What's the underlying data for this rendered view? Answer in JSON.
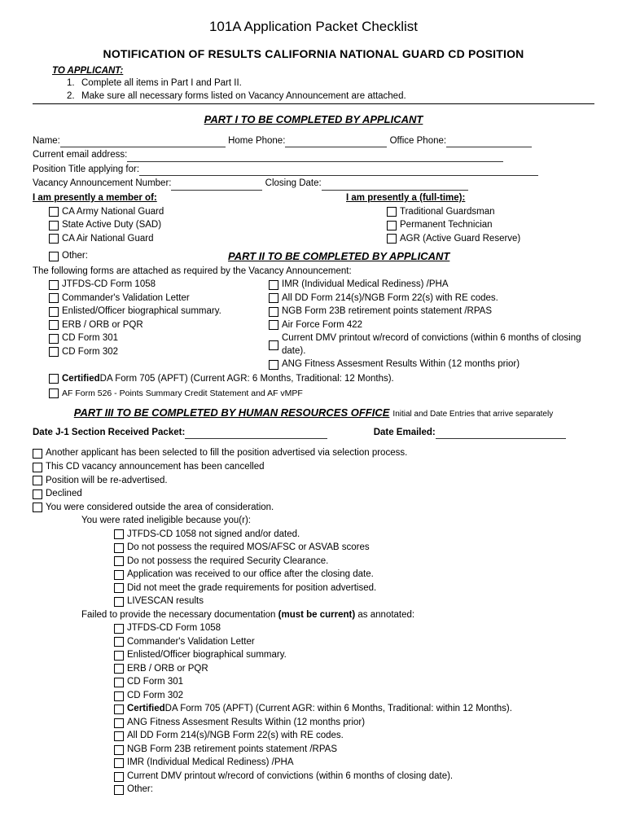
{
  "header": {
    "title": "101A Application Packet Checklist",
    "subtitle": "NOTIFICATION OF RESULTS CALIFORNIA NATIONAL GUARD  CD  POSITION",
    "to_applicant": "TO APPLICANT:",
    "instr1_num": "1.",
    "instr1": "Complete all items in Part I and Part II.",
    "instr2_num": "2.",
    "instr2": "Make sure all necessary forms listed on Vacancy Announcement are attached."
  },
  "part1": {
    "header": "PART I TO BE COMPLETED BY APPLICANT",
    "name": "Name:",
    "home_phone": "Home Phone:",
    "office_phone": "Office Phone:",
    "email": "Current email address:",
    "position": "Position Title applying for:",
    "vacancy": "Vacancy Announcement Number:",
    "closing": "Closing Date:",
    "member_hdr": "I am presently a member of:",
    "fulltime_hdr": "I am presently a (full-time):",
    "member_items": [
      "CA Army National Guard",
      "State Active Duty (SAD)",
      "CA Air National Guard"
    ],
    "fulltime_items": [
      "Traditional Guardsman",
      "Permanent Technician",
      "AGR (Active Guard Reserve)"
    ],
    "other": "Other:"
  },
  "part2": {
    "header": "PART II TO BE COMPLETED BY APPLICANT",
    "intro": "The following forms are attached as required by the Vacancy Announcement:",
    "left": [
      "JTFDS-CD Form 1058",
      "Commander's Validation Letter",
      "Enlisted/Officer biographical summary.",
      "ERB / ORB or PQR",
      "CD Form  301",
      "CD Form  302"
    ],
    "right": [
      "IMR (Individual Medical Rediness) /PHA",
      "All DD Form 214(s)/NGB Form 22(s) with RE codes.",
      "NGB Form 23B retirement points statement /RPAS",
      "Air Force Form 422",
      "Current DMV printout w/record of convictions (within 6 months of closing date).",
      "ANG Fitness Assesment Results Within (12 months prior)"
    ],
    "certified_b": "Certified",
    "certified_rest": " DA Form 705 (APFT) (Current AGR: 6 Months, Traditional: 12 Months).",
    "af526": "AF Form 526 - Points Summary Credit Statement and AF vMPF"
  },
  "part3": {
    "header": "PART III TO BE COMPLETED BY HUMAN RESOURCES OFFICE",
    "side_note": "Initial and Date Entries that arrive separately",
    "date_j1": "Date  J-1 Section Received Packet:",
    "date_emailed": "Date Emailed:",
    "top": [
      "Another applicant has been selected to fill the position advertised via selection process.",
      "This CD vacancy announcement has been cancelled",
      "Position will be re-advertised.",
      "Declined",
      "You were considered outside the area of consideration."
    ],
    "ineligible_hdr": "You were rated ineligible because you(r):",
    "ineligible": [
      "JTFDS-CD 1058  not signed and/or dated.",
      "Do not possess the required MOS/AFSC or ASVAB scores",
      "Do not possess the required Security Clearance.",
      "Application was received to our office after the closing date.",
      "Did not meet the grade requirements for position advertised.",
      "LIVESCAN results"
    ],
    "failed_pre": "Failed to provide the necessary documentation ",
    "failed_b": "(must be current)",
    "failed_post": " as annotated:",
    "docs": [
      "JTFDS-CD Form 1058",
      "Commander's Validation Letter",
      "Enlisted/Officer biographical summary.",
      "ERB / ORB or PQR",
      "CD Form  301",
      "CD Form  302"
    ],
    "docs_cert_b": "Certified",
    "docs_cert_rest": " DA Form 705 (APFT) (Current AGR: within 6 Months, Traditional: within 12 Months).",
    "docs2": [
      "ANG Fitness Assesment Results Within (12 months prior)",
      "All DD Form 214(s)/NGB Form 22(s) with RE codes.",
      "NGB Form 23B retirement points statement /RPAS",
      "IMR (Individual Medical Rediness) /PHA",
      "Current DMV printout w/record of convictions (within 6 months of closing date).",
      "Other:"
    ]
  }
}
